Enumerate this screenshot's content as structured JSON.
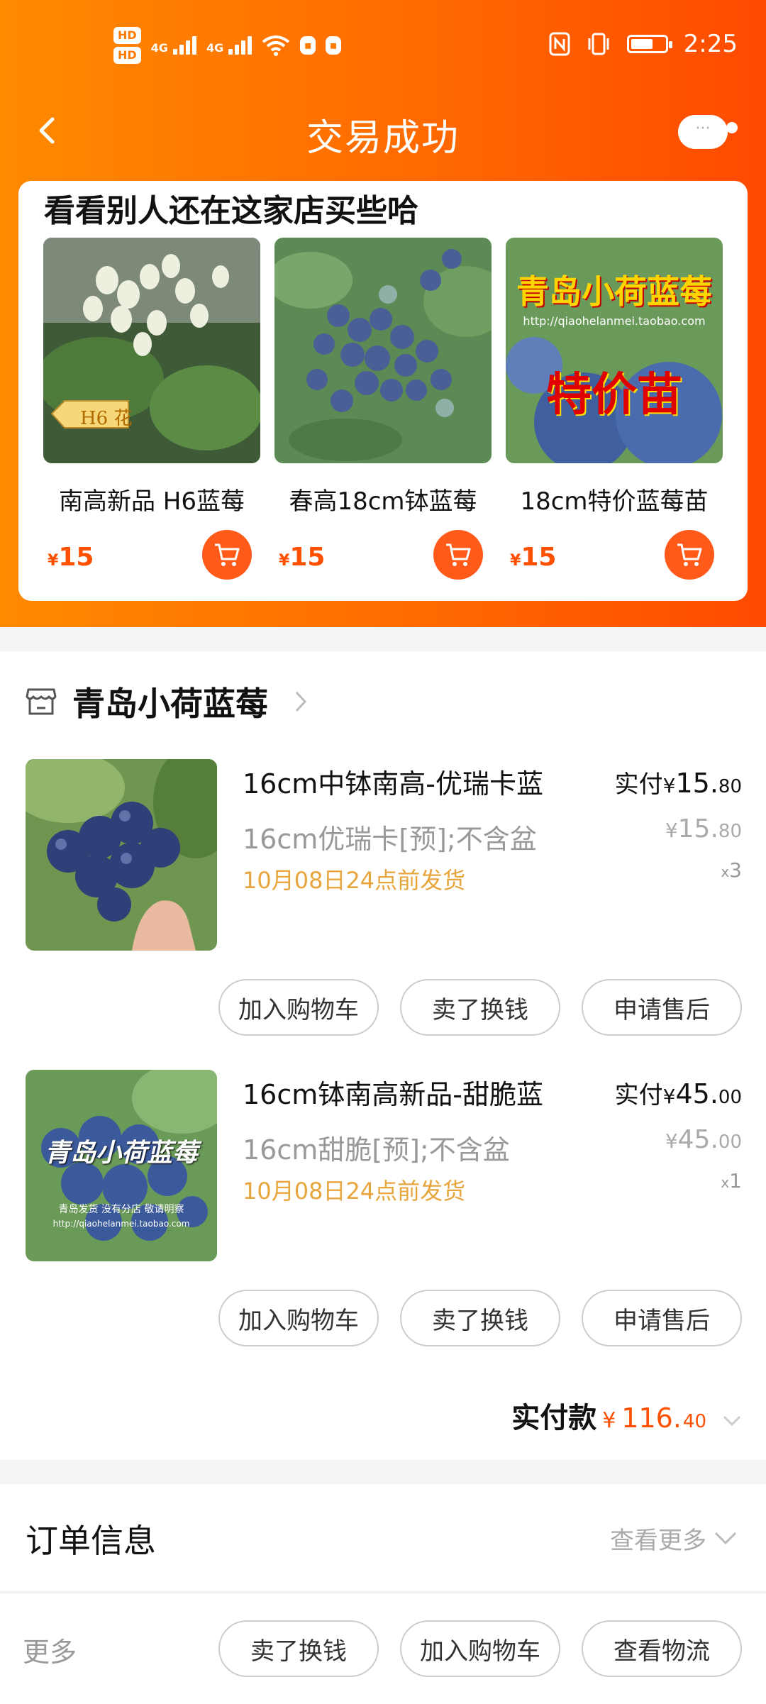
{
  "status_bar": {
    "hd1": "HD",
    "hd2": "HD",
    "net1": "4G",
    "net2": "4G",
    "time": "2:25",
    "battery_level": 0.65
  },
  "nav": {
    "title": "交易成功",
    "message_badge": "···"
  },
  "recommend": {
    "heading": "看看别人还在这家店买些哈",
    "items": [
      {
        "name": "南高新品 H6蓝莓",
        "price_symbol": "¥",
        "price": "15",
        "tag": "H6 花"
      },
      {
        "name": "春高18cm钵蓝莓",
        "price_symbol": "¥",
        "price": "15"
      },
      {
        "name": "18cm特价蓝莓苗",
        "price_symbol": "¥",
        "price": "15",
        "overlay_title": "青岛小荷蓝莓",
        "overlay_promo": "特价苗",
        "overlay_url": "http://qiaohelanmei.taobao.com"
      }
    ]
  },
  "shop": {
    "name": "青岛小荷蓝莓"
  },
  "order_items": [
    {
      "title": "16cm中钵南高-优瑞卡蓝",
      "spec": "16cm优瑞卡[预];不含盆",
      "ship": "10月08日24点前发货",
      "paid_label": "实付",
      "yen": "¥",
      "paid_int": "15.",
      "paid_dec": "80",
      "unit_int": "15.",
      "unit_dec": "80",
      "qty_x": "x",
      "qty": "3",
      "buttons": [
        "加入购物车",
        "卖了换钱",
        "申请售后"
      ]
    },
    {
      "title": "16cm钵南高新品-甜脆蓝",
      "spec": "16cm甜脆[预];不含盆",
      "ship": "10月08日24点前发货",
      "paid_label": "实付",
      "yen": "¥",
      "paid_int": "45.",
      "paid_dec": "00",
      "unit_int": "45.",
      "unit_dec": "00",
      "qty_x": "x",
      "qty": "1",
      "buttons": [
        "加入购物车",
        "卖了换钱",
        "申请售后"
      ],
      "overlay_title": "青岛小荷蓝莓",
      "overlay_text": "青岛发货 没有分店 敬请明察",
      "overlay_url": "http://qiaohelanmei.taobao.com"
    }
  ],
  "total": {
    "label": "实付款",
    "yen": "¥",
    "int": "116.",
    "dec": "40"
  },
  "order_info": {
    "title": "订单信息",
    "more": "查看更多"
  },
  "bottom_bar": {
    "more": "更多",
    "buttons": [
      "卖了换钱",
      "加入购物车",
      "查看物流"
    ]
  },
  "colors": {
    "brand_orange": "#ff6a00",
    "price_orange": "#ff5000",
    "ship_amber": "#e8a53c"
  }
}
